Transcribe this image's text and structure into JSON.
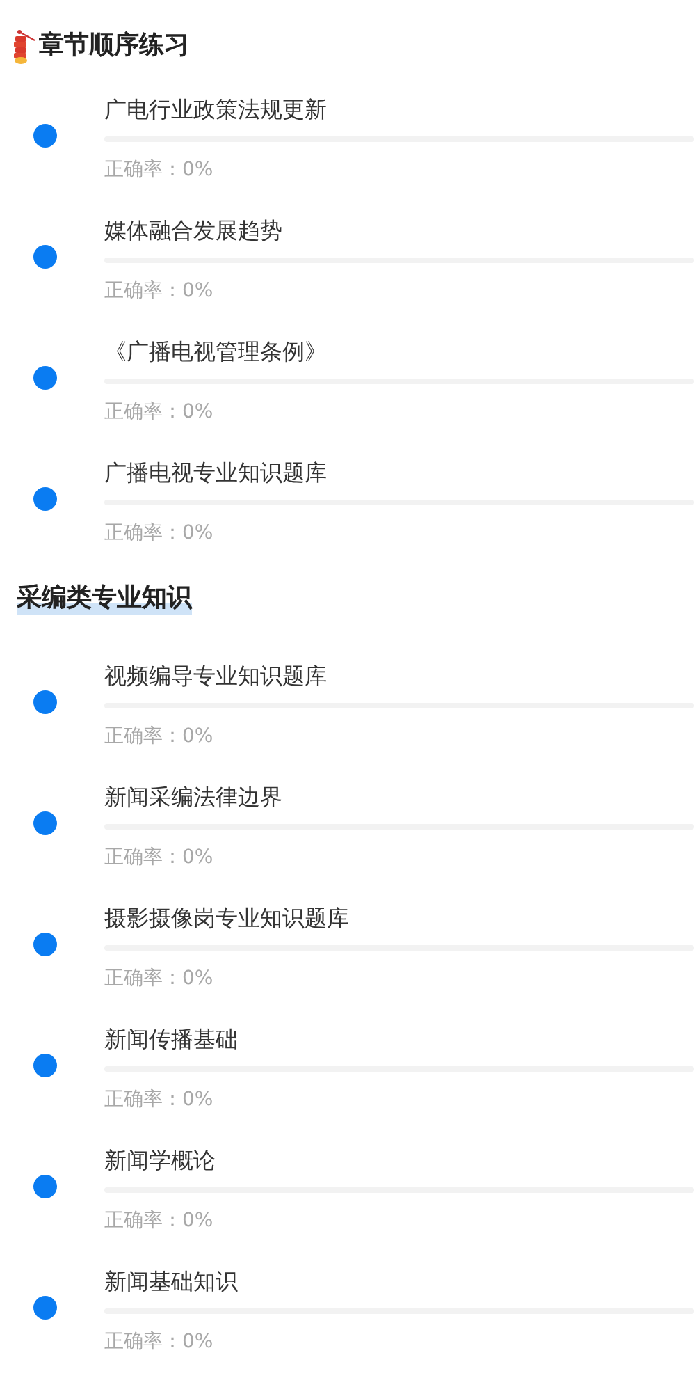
{
  "sections": [
    {
      "kind": "firecracker",
      "title": "章节顺序练习",
      "items": [
        {
          "title": "广电行业政策法规更新",
          "level": 0,
          "rate_label": "正确率：0%"
        },
        {
          "title": "媒体融合发展趋势",
          "level": 0,
          "rate_label": "正确率：0%"
        },
        {
          "title": "《广播电视管理条例》",
          "level": 0,
          "rate_label": "正确率：0%"
        },
        {
          "title": "广播电视专业知识题库",
          "level": 0,
          "rate_label": "正确率：0%"
        }
      ]
    },
    {
      "kind": "underline",
      "title": "采编类专业知识",
      "items": [
        {
          "title": "视频编导专业知识题库",
          "level": 0,
          "rate_label": "正确率：0%"
        },
        {
          "title": "新闻采编法律边界",
          "level": 0,
          "rate_label": "正确率：0%"
        },
        {
          "title": "摄影摄像岗专业知识题库",
          "level": 0,
          "rate_label": "正确率：0%"
        },
        {
          "title": "新闻传播基础",
          "level": 0,
          "rate_label": "正确率：0%"
        },
        {
          "title": "新闻学概论",
          "level": 0,
          "rate_label": "正确率：0%"
        },
        {
          "title": "新闻基础知识",
          "level": 0,
          "rate_label": "正确率：0%"
        }
      ]
    }
  ]
}
